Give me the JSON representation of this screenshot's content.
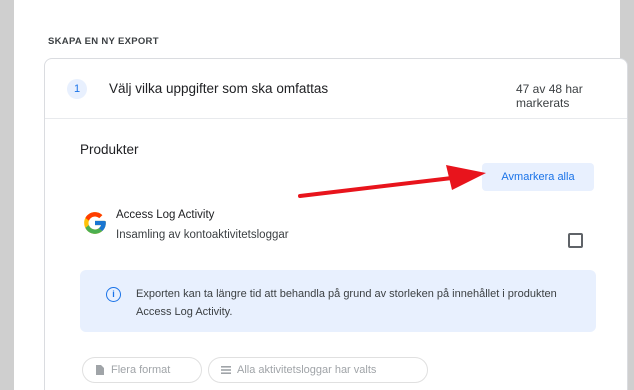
{
  "section": {
    "heading": "SKAPA EN NY EXPORT"
  },
  "step": {
    "number": "1",
    "title": "Välj vilka uppgifter som ska omfattas",
    "count": "47 av 48 har markerats"
  },
  "products": {
    "label": "Produkter",
    "deselect_all": "Avmarkera alla",
    "item": {
      "name": "Access Log Activity",
      "description": "Insamling av kontoaktivitetsloggar",
      "checked": false
    }
  },
  "info": {
    "icon": "info-icon",
    "text": "Exporten kan ta längre tid att behandla på grund av storleken på innehållet i produkten Access Log Activity."
  },
  "chips": [
    {
      "label": "Flera format",
      "icon": "file-icon"
    },
    {
      "label": "Alla aktivitetsloggar har valts",
      "icon": "list-icon"
    }
  ],
  "colors": {
    "accent": "#1a73e8",
    "arrow": "#e8141c",
    "info_bg": "#e8f0fe"
  }
}
